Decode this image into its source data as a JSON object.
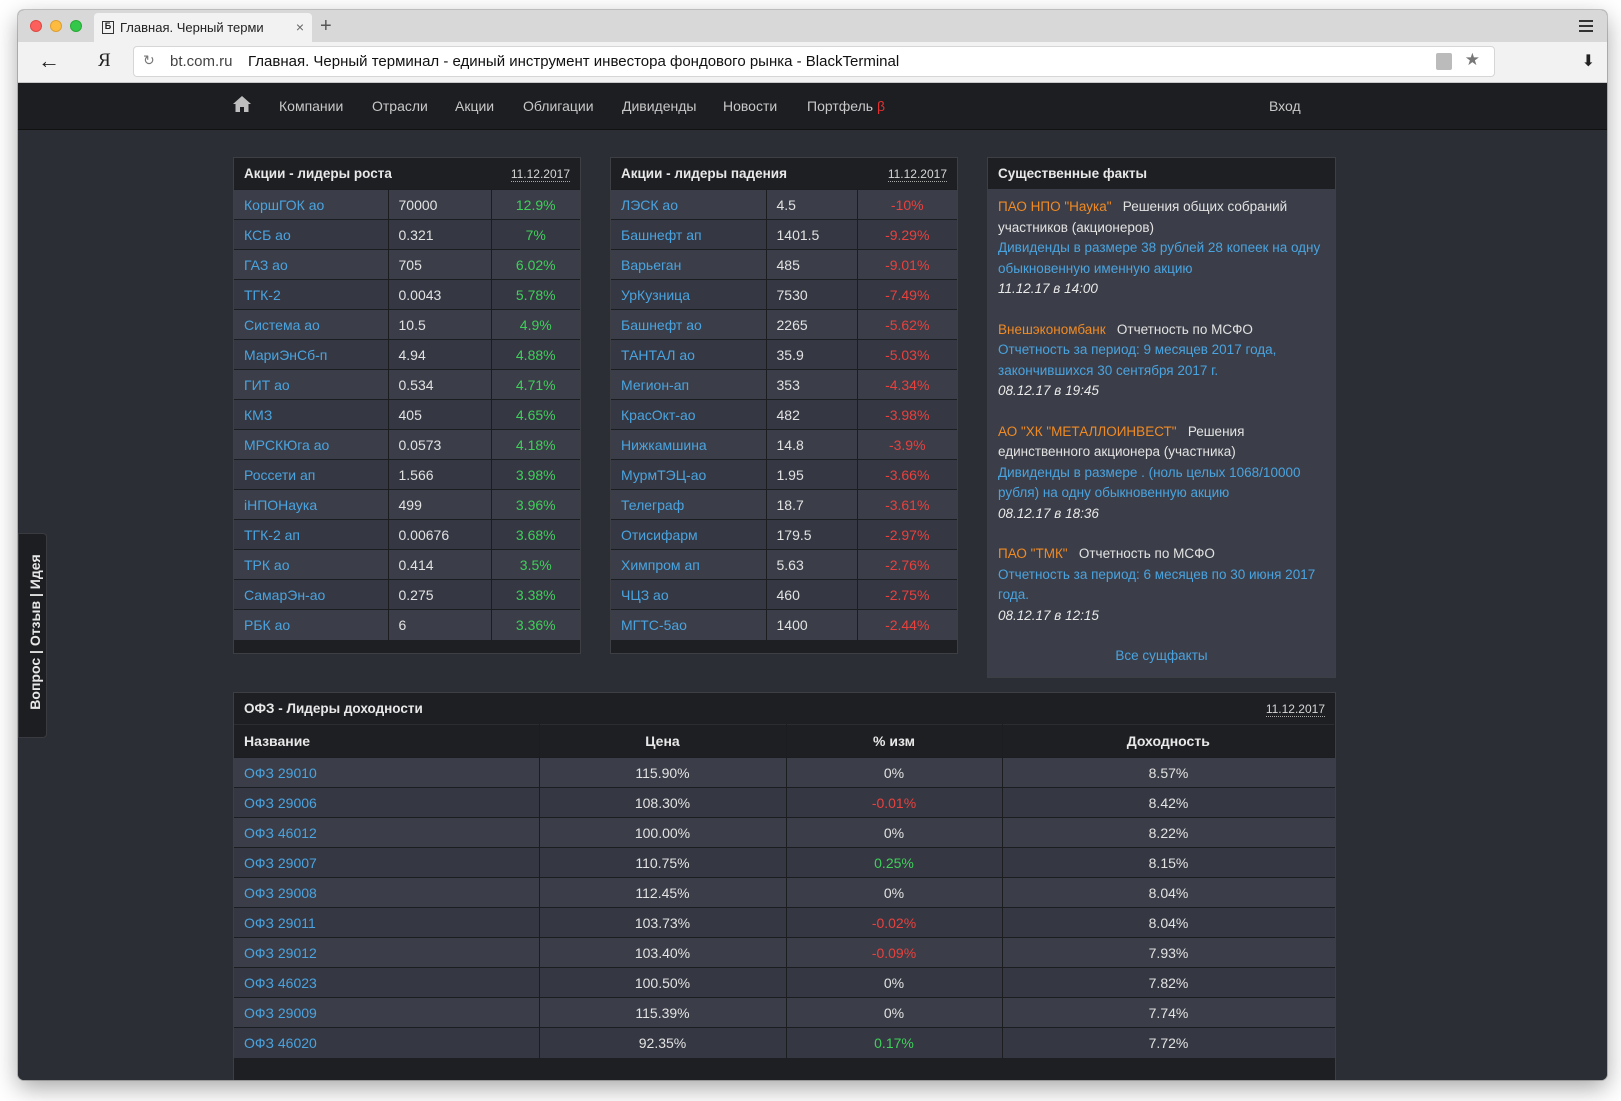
{
  "browser": {
    "tab_title": "Главная. Черный терми",
    "domain": "bt.com.ru",
    "page_title": "Главная. Черный терминал - единый инструмент инвестора фондового рынка - BlackTerminal",
    "ya_label": "Я",
    "new_tab": "+",
    "close_tab": "×"
  },
  "nav": {
    "items": [
      "Компании",
      "Отрасли",
      "Акции",
      "Облигации",
      "Дивиденды",
      "Новости",
      "Портфель"
    ],
    "beta": "β",
    "login": "Вход"
  },
  "gainers": {
    "title": "Акции - лидеры роста",
    "date": "11.12.2017",
    "rows": [
      [
        "КоршГОК ао",
        "70000",
        "12.9%"
      ],
      [
        "КСБ ао",
        "0.321",
        "7%"
      ],
      [
        "ГАЗ ао",
        "705",
        "6.02%"
      ],
      [
        "ТГК-2",
        "0.0043",
        "5.78%"
      ],
      [
        "Система ао",
        "10.5",
        "4.9%"
      ],
      [
        "МариЭнСб-п",
        "4.94",
        "4.88%"
      ],
      [
        "ГИТ ао",
        "0.534",
        "4.71%"
      ],
      [
        "КМЗ",
        "405",
        "4.65%"
      ],
      [
        "МРСКЮга ао",
        "0.0573",
        "4.18%"
      ],
      [
        "Россети ап",
        "1.566",
        "3.98%"
      ],
      [
        "iНПОНаука",
        "499",
        "3.96%"
      ],
      [
        "ТГК-2 ап",
        "0.00676",
        "3.68%"
      ],
      [
        "ТРК ао",
        "0.414",
        "3.5%"
      ],
      [
        "СамарЭн-ао",
        "0.275",
        "3.38%"
      ],
      [
        "РБК ао",
        "6",
        "3.36%"
      ]
    ]
  },
  "losers": {
    "title": "Акции - лидеры падения",
    "date": "11.12.2017",
    "rows": [
      [
        "ЛЭСК ао",
        "4.5",
        "-10%"
      ],
      [
        "Башнефт ап",
        "1401.5",
        "-9.29%"
      ],
      [
        "Варьеган",
        "485",
        "-9.01%"
      ],
      [
        "УрКузница",
        "7530",
        "-7.49%"
      ],
      [
        "Башнефт ао",
        "2265",
        "-5.62%"
      ],
      [
        "ТАНТАЛ ао",
        "35.9",
        "-5.03%"
      ],
      [
        "Мегион-ап",
        "353",
        "-4.34%"
      ],
      [
        "КрасОкт-ао",
        "482",
        "-3.98%"
      ],
      [
        "Нижкамшина",
        "14.8",
        "-3.9%"
      ],
      [
        "МурмТЭЦ-ао",
        "1.95",
        "-3.66%"
      ],
      [
        "Телеграф",
        "18.7",
        "-3.61%"
      ],
      [
        "Отисифарм",
        "179.5",
        "-2.97%"
      ],
      [
        "Химпром ап",
        "5.63",
        "-2.76%"
      ],
      [
        "ЧЦЗ ао",
        "460",
        "-2.75%"
      ],
      [
        "МГТС-5ао",
        "1400",
        "-2.44%"
      ]
    ]
  },
  "facts": {
    "title": "Существенные факты",
    "items": [
      {
        "company": "ПАО НПО \"Наука\"",
        "type": "Решения общих собраний участников (акционеров)",
        "link": "Дивиденды в размере 38 рублей 28 копеек на одну обыкновенную именную акцию",
        "time": "11.12.17 в 14:00"
      },
      {
        "company": "Внешэкономбанк",
        "type": "Отчетность по МСФО",
        "link": "Отчетность за период: 9 месяцев 2017 года, закончившихся 30 сентября 2017 г.",
        "time": "08.12.17 в 19:45"
      },
      {
        "company": "АО \"ХК \"МЕТАЛЛОИНВЕСТ\"",
        "type": "Решения единственного акционера (участника)",
        "link": "Дивиденды в размере . (ноль целых 1068/10000 рубля) на одну обыкновенную акцию",
        "time": "08.12.17 в 18:36"
      },
      {
        "company": "ПАО \"ТМК\"",
        "type": "Отчетность по МСФО",
        "link": "Отчетность за период: 6 месяцев по 30 июня 2017 года.",
        "time": "08.12.17 в 12:15"
      }
    ],
    "all_link": "Все сущфакты"
  },
  "ofz": {
    "title": "ОФЗ - Лидеры доходности",
    "date": "11.12.2017",
    "columns": [
      "Название",
      "Цена",
      "% изм",
      "Доходность"
    ],
    "rows": [
      [
        "ОФЗ 29010",
        "115.90%",
        "0%",
        "8.57%"
      ],
      [
        "ОФЗ 29006",
        "108.30%",
        "-0.01%",
        "8.42%"
      ],
      [
        "ОФЗ 46012",
        "100.00%",
        "0%",
        "8.22%"
      ],
      [
        "ОФЗ 29007",
        "110.75%",
        "0.25%",
        "8.15%"
      ],
      [
        "ОФЗ 29008",
        "112.45%",
        "0%",
        "8.04%"
      ],
      [
        "ОФЗ 29011",
        "103.73%",
        "-0.02%",
        "8.04%"
      ],
      [
        "ОФЗ 29012",
        "103.40%",
        "-0.09%",
        "7.93%"
      ],
      [
        "ОФЗ 46023",
        "100.50%",
        "0%",
        "7.82%"
      ],
      [
        "ОФЗ 29009",
        "115.39%",
        "0%",
        "7.74%"
      ],
      [
        "ОФЗ 46020",
        "92.35%",
        "0.17%",
        "7.72%"
      ]
    ]
  },
  "feedback_tab": "Вопрос | Отзыв | Идея",
  "colors": {
    "link": "#4aa3df",
    "positive": "#3fcf5a",
    "negative": "#e8413e",
    "company": "#f08a24"
  }
}
